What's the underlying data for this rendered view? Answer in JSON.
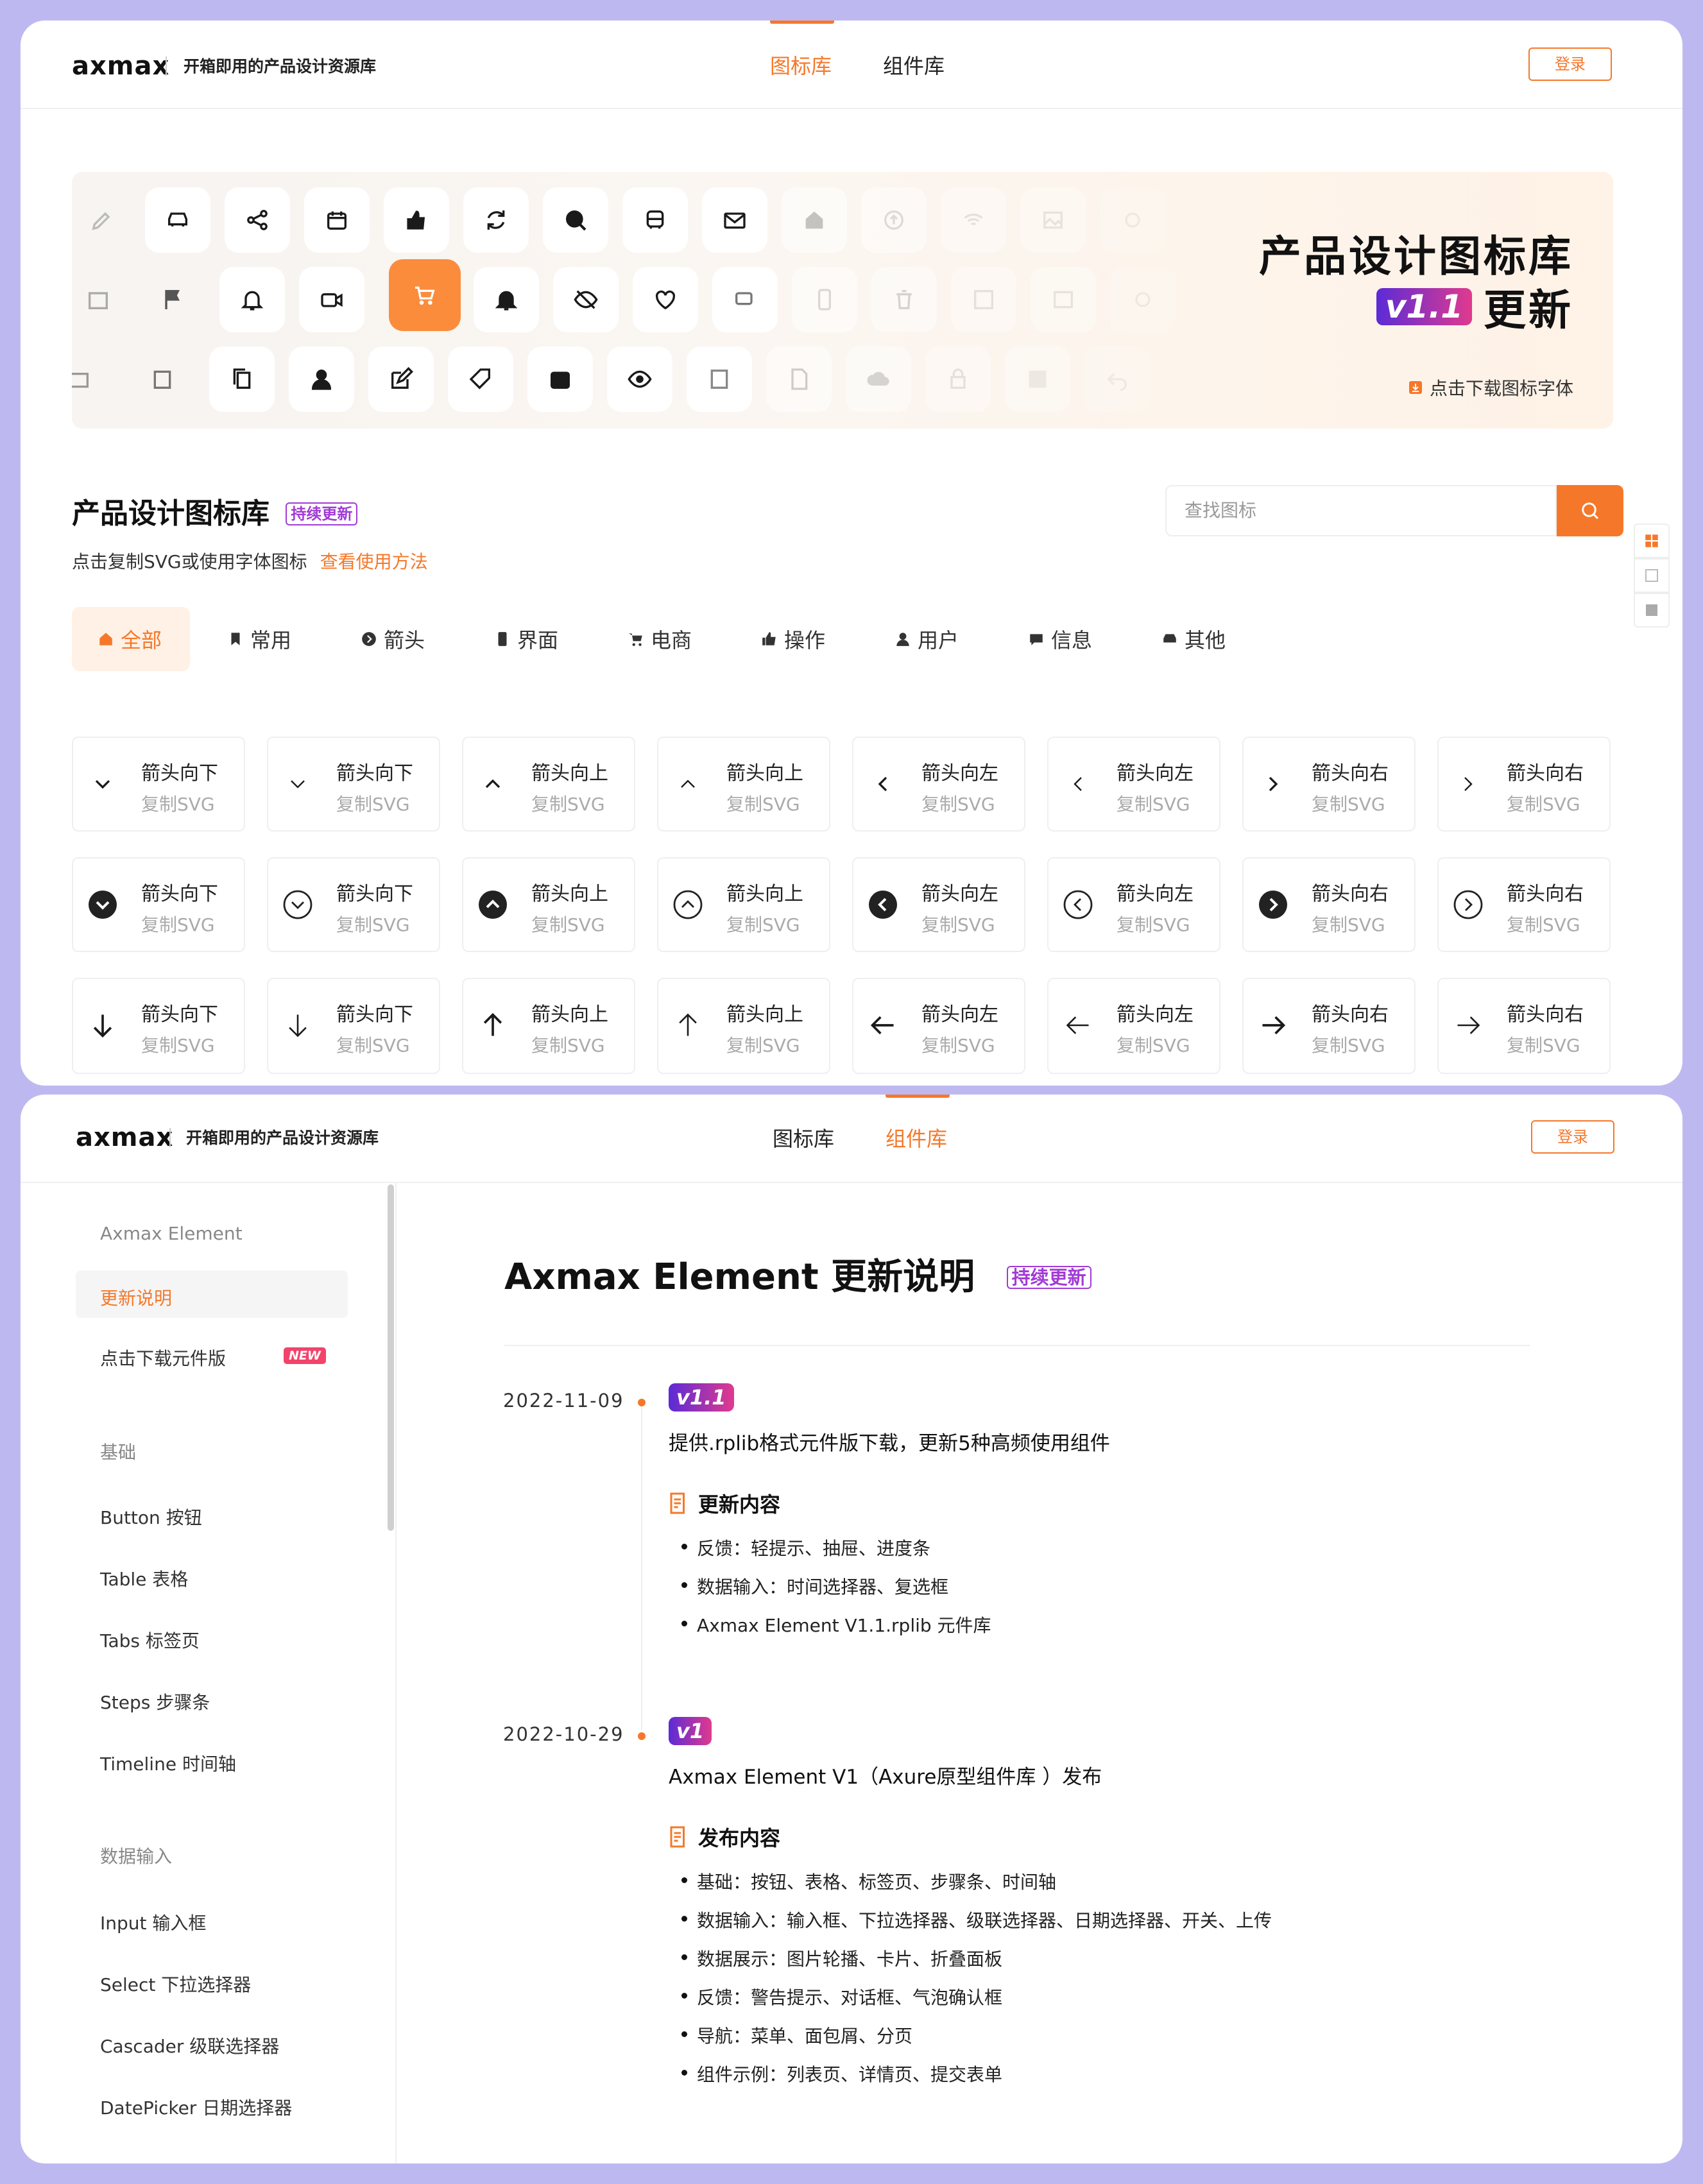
{
  "brand": {
    "logo": "axmax",
    "tagline": "开箱即用的产品设计资源库"
  },
  "nav": {
    "icons": "图标库",
    "components": "组件库",
    "login": "登录"
  },
  "banner": {
    "title": "产品设计图标库",
    "version": "v1.1",
    "update": "更新",
    "download": "点击下载图标字体",
    "slides": 2,
    "active_slide": 1
  },
  "section": {
    "title": "产品设计图标库",
    "badge": "持续更新",
    "subtitle": "点击复制SVG或使用字体图标",
    "howto": "查看使用方法"
  },
  "search": {
    "placeholder": "查找图标"
  },
  "view_toggle": [
    "grid-view-icon",
    "list-view-icon",
    "compact-view-icon"
  ],
  "categories": [
    {
      "label": "全部",
      "icon": "home-icon"
    },
    {
      "label": "常用",
      "icon": "bookmark-icon"
    },
    {
      "label": "箭头",
      "icon": "arrow-circle-icon"
    },
    {
      "label": "界面",
      "icon": "phone-icon"
    },
    {
      "label": "电商",
      "icon": "cart-icon"
    },
    {
      "label": "操作",
      "icon": "thumb-up-icon"
    },
    {
      "label": "用户",
      "icon": "user-icon"
    },
    {
      "label": "信息",
      "icon": "message-icon"
    },
    {
      "label": "其他",
      "icon": "car-icon"
    }
  ],
  "icons": [
    {
      "name": "箭头向下",
      "copy": "复制SVG"
    },
    {
      "name": "箭头向下",
      "copy": "复制SVG"
    },
    {
      "name": "箭头向上",
      "copy": "复制SVG"
    },
    {
      "name": "箭头向上",
      "copy": "复制SVG"
    },
    {
      "name": "箭头向左",
      "copy": "复制SVG"
    },
    {
      "name": "箭头向左",
      "copy": "复制SVG"
    },
    {
      "name": "箭头向右",
      "copy": "复制SVG"
    },
    {
      "name": "箭头向右",
      "copy": "复制SVG"
    },
    {
      "name": "箭头向下",
      "copy": "复制SVG"
    },
    {
      "name": "箭头向下",
      "copy": "复制SVG"
    },
    {
      "name": "箭头向上",
      "copy": "复制SVG"
    },
    {
      "name": "箭头向上",
      "copy": "复制SVG"
    },
    {
      "name": "箭头向左",
      "copy": "复制SVG"
    },
    {
      "name": "箭头向左",
      "copy": "复制SVG"
    },
    {
      "name": "箭头向右",
      "copy": "复制SVG"
    },
    {
      "name": "箭头向右",
      "copy": "复制SVG"
    },
    {
      "name": "箭头向下",
      "copy": "复制SVG"
    },
    {
      "name": "箭头向下",
      "copy": "复制SVG"
    },
    {
      "name": "箭头向上",
      "copy": "复制SVG"
    },
    {
      "name": "箭头向上",
      "copy": "复制SVG"
    },
    {
      "name": "箭头向左",
      "copy": "复制SVG"
    },
    {
      "name": "箭头向左",
      "copy": "复制SVG"
    },
    {
      "name": "箭头向右",
      "copy": "复制SVG"
    },
    {
      "name": "箭头向右",
      "copy": "复制SVG"
    }
  ],
  "sidebar": {
    "items": [
      {
        "label": "Axmax Element",
        "type": "group"
      },
      {
        "label": "更新说明",
        "type": "item",
        "active": true
      },
      {
        "label": "点击下载元件版",
        "type": "item",
        "tag": "NEW"
      },
      {
        "label": "基础",
        "type": "group"
      },
      {
        "label": "Button 按钮",
        "type": "item"
      },
      {
        "label": "Table 表格",
        "type": "item"
      },
      {
        "label": "Tabs 标签页",
        "type": "item"
      },
      {
        "label": "Steps 步骤条",
        "type": "item"
      },
      {
        "label": "Timeline 时间轴",
        "type": "item"
      },
      {
        "label": "数据输入",
        "type": "group"
      },
      {
        "label": "Input 输入框",
        "type": "item"
      },
      {
        "label": "Select 下拉选择器",
        "type": "item"
      },
      {
        "label": "Cascader 级联选择器",
        "type": "item"
      },
      {
        "label": "DatePicker 日期选择器",
        "type": "item"
      }
    ]
  },
  "doc": {
    "title": "Axmax Element 更新说明",
    "badge": "持续更新",
    "entries": [
      {
        "date": "2022-11-09",
        "version": "v1.1",
        "desc": "提供.rplib格式元件版下载，更新5种高频使用组件",
        "heading": "更新内容",
        "items": [
          "反馈：轻提示、抽屉、进度条",
          "数据输入：时间选择器、复选框",
          "Axmax Element V1.1.rplib 元件库"
        ]
      },
      {
        "date": "2022-10-29",
        "version": "v1",
        "desc": "Axmax Element V1（Axure原型组件库 ）发布",
        "heading": "发布内容",
        "items": [
          "基础：按钮、表格、标签页、步骤条、时间轴",
          "数据输入：输入框、下拉选择器、级联选择器、日期选择器、开关、上传",
          "数据展示：图片轮播、卡片、折叠面板",
          "反馈：警告提示、对话框、气泡确认框",
          "导航：菜单、面包屑、分页",
          "组件示例：列表页、详情页、提交表单"
        ]
      }
    ]
  },
  "colors": {
    "accent": "#f5782a",
    "bg": "#bdb9f0",
    "badge": "#a23bd6",
    "new": "#f2436b"
  }
}
